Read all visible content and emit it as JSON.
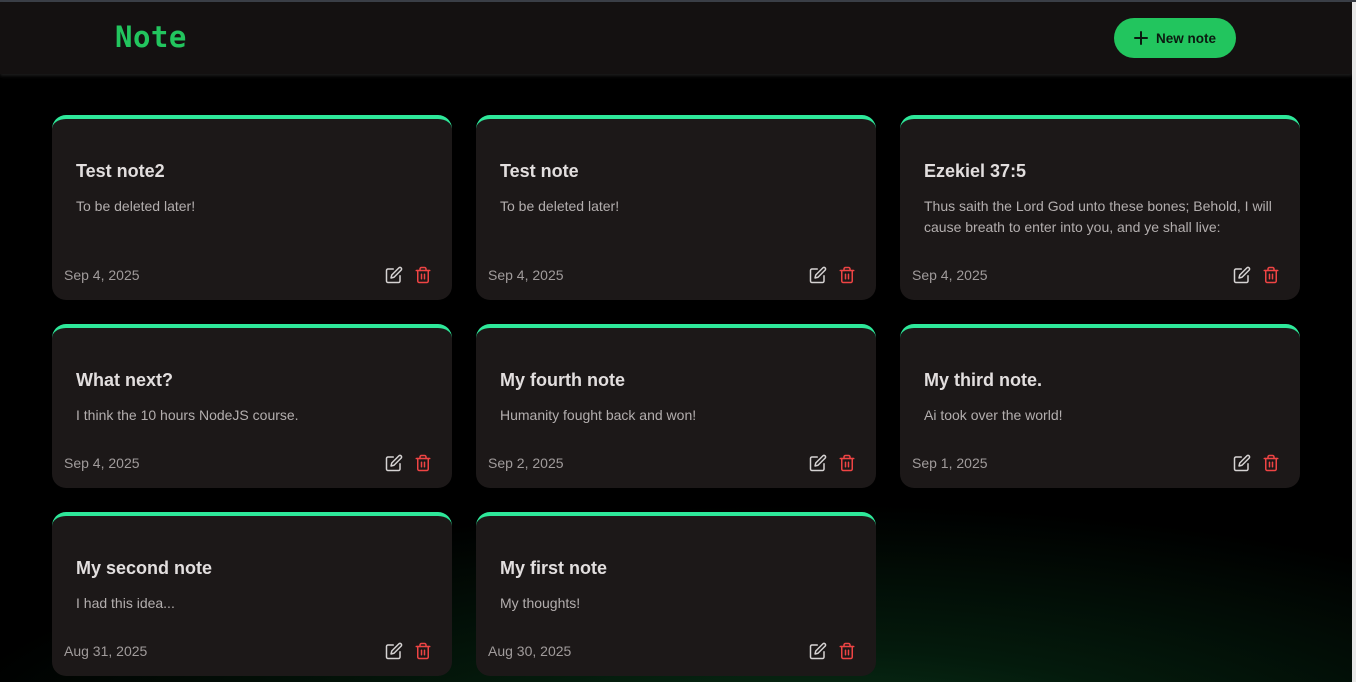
{
  "header": {
    "title": "Note",
    "new_note_label": "New note"
  },
  "colors": {
    "accent": "#22c55e",
    "card_top_border": "#2ee89a",
    "delete": "#ef4444",
    "card_bg": "#1c1818"
  },
  "notes": [
    {
      "title": "Test note2",
      "body": "To be deleted later!",
      "date": "Sep 4, 2025"
    },
    {
      "title": "Test note",
      "body": "To be deleted later!",
      "date": "Sep 4, 2025"
    },
    {
      "title": "Ezekiel 37:5",
      "body": "Thus saith the Lord God unto these bones; Behold, I will cause breath to enter into you, and ye shall live:",
      "date": "Sep 4, 2025"
    },
    {
      "title": "What next?",
      "body": "I think the 10 hours NodeJS course.",
      "date": "Sep 4, 2025"
    },
    {
      "title": "My fourth note",
      "body": "Humanity fought back and won!",
      "date": "Sep 2, 2025"
    },
    {
      "title": "My third note.",
      "body": "Ai took over the world!",
      "date": "Sep 1, 2025"
    },
    {
      "title": "My second note",
      "body": "I had this idea...",
      "date": "Aug 31, 2025"
    },
    {
      "title": "My first note",
      "body": "My thoughts!",
      "date": "Aug 30, 2025"
    }
  ],
  "icons": {
    "new": "plus-icon",
    "edit": "edit-icon",
    "delete": "trash-icon"
  }
}
